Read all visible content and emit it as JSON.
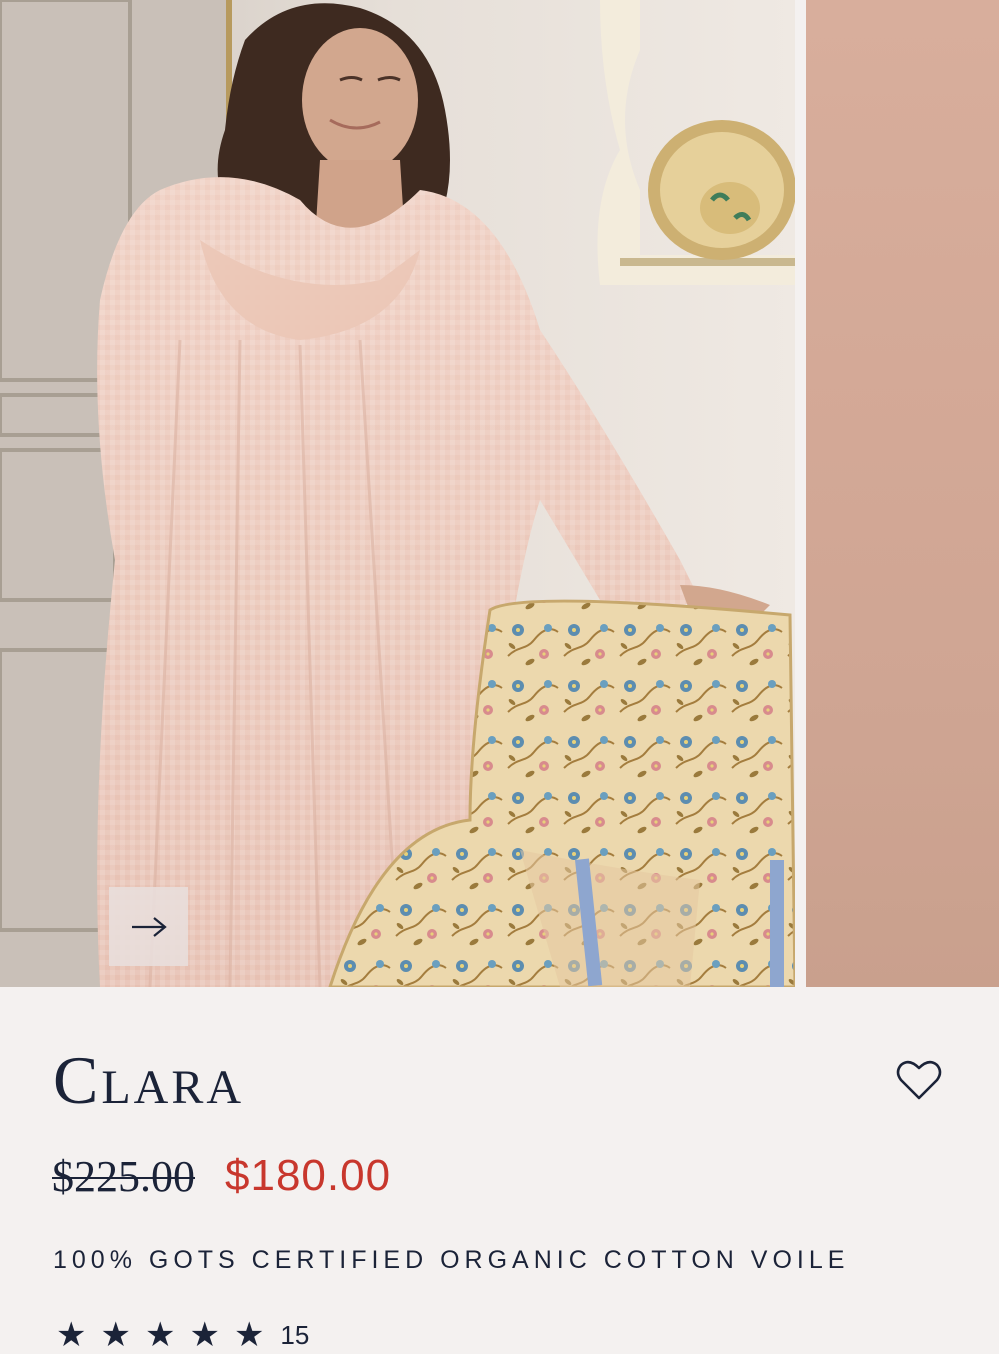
{
  "product": {
    "name": "Clara",
    "original_price": "$225.00",
    "sale_price": "$180.00",
    "description": "100% GOTS CERTIFIED ORGANIC COTTON VOILE",
    "rating_count": "15"
  },
  "gallery": {
    "main_image_alt": "Woman in pink gingham nightgown leaning on floral armchair",
    "next_image_alt": "Pink backdrop product image",
    "next_icon": "arrow-right-icon"
  },
  "icons": {
    "wishlist": "heart-icon",
    "rating": "star-icon"
  },
  "colors": {
    "navy": "#1b2338",
    "sale_red": "#c8372d",
    "background": "#f4f1f0"
  }
}
